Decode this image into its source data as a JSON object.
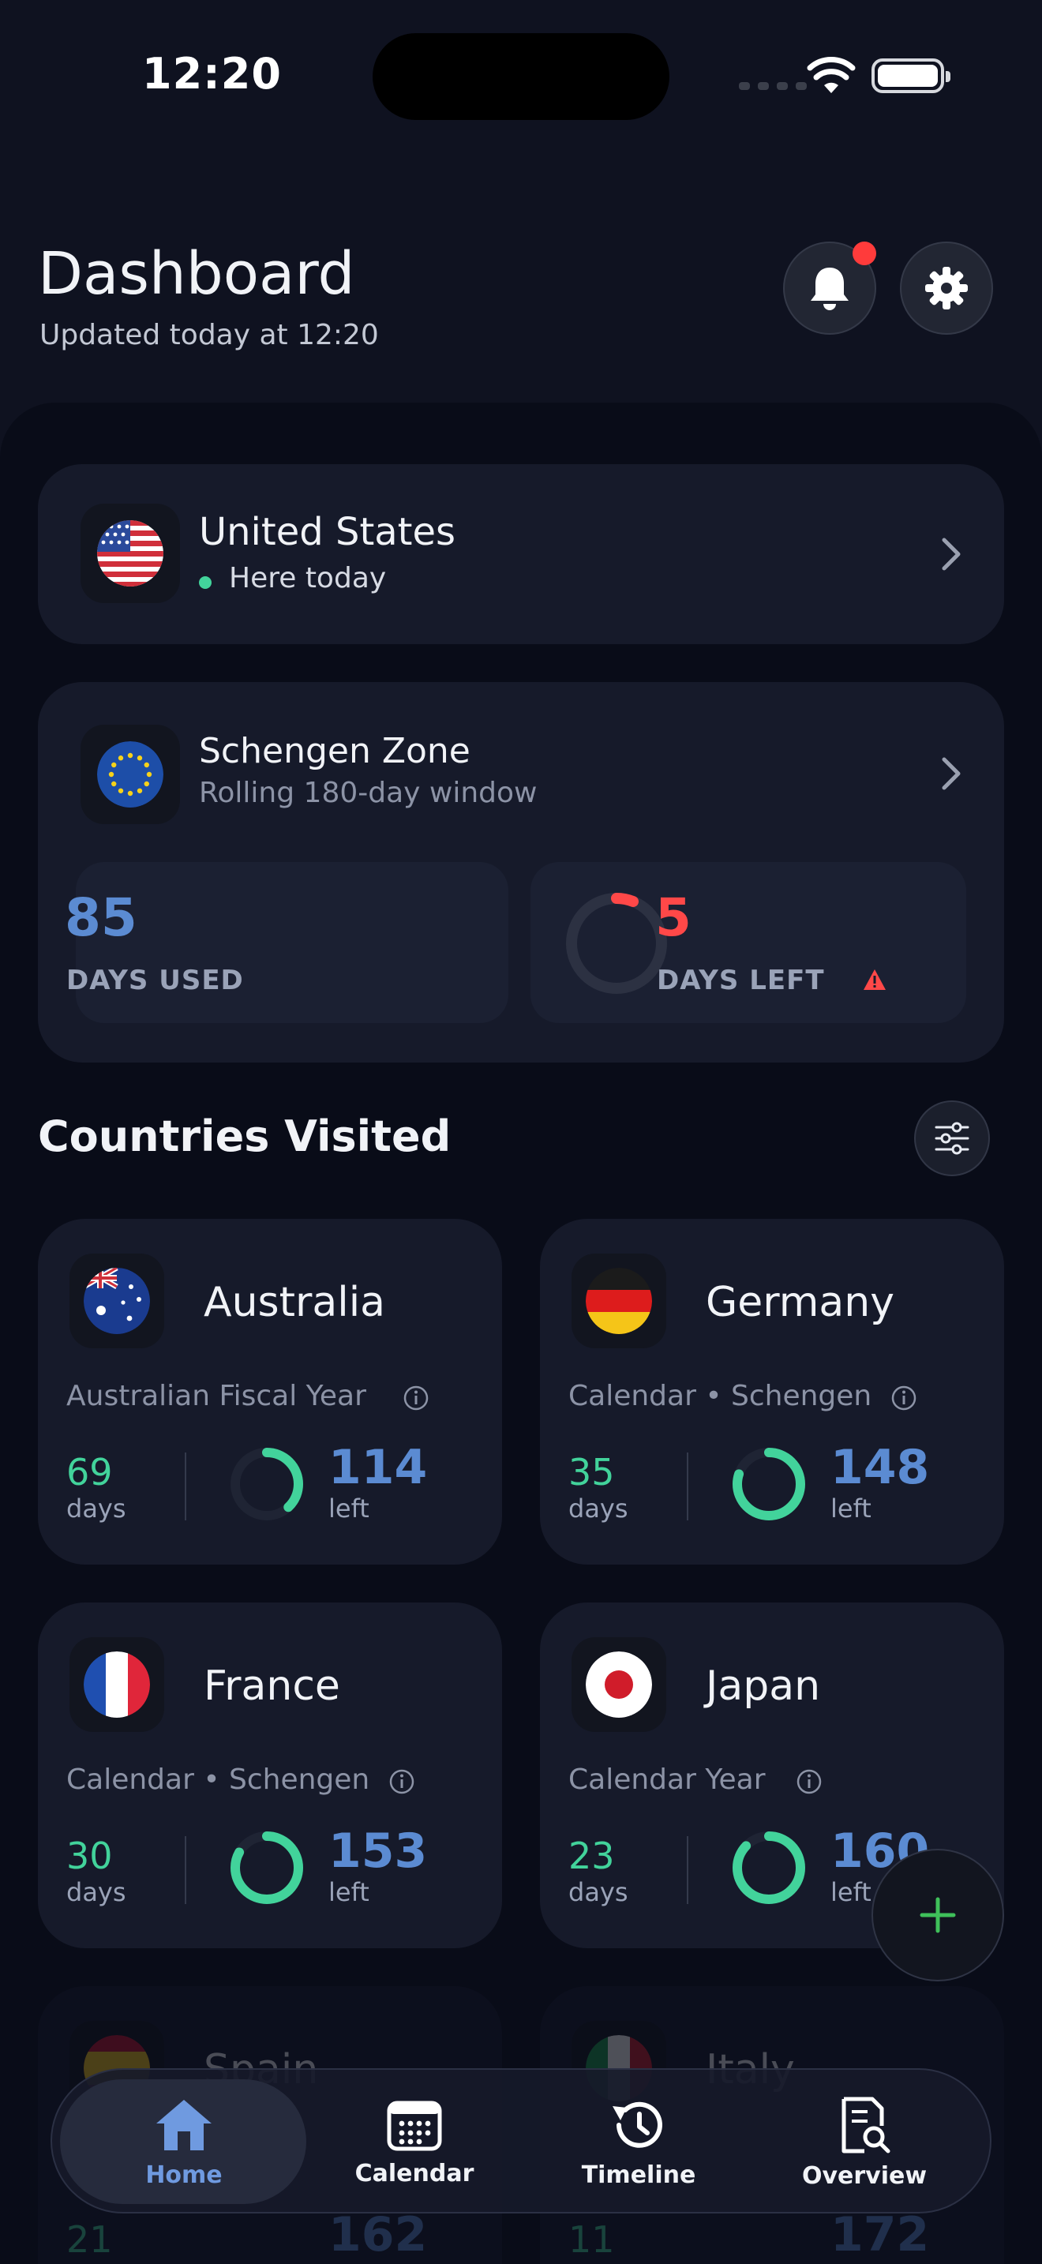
{
  "status_bar": {
    "time": "12:20"
  },
  "header": {
    "title": "Dashboard",
    "subtitle": "Updated today at 12:20"
  },
  "current_location": {
    "country": "United States",
    "status": "Here today",
    "flag_icon": "us-flag-icon"
  },
  "schengen": {
    "title": "Schengen Zone",
    "subtitle": "Rolling 180-day window",
    "days_used": "85",
    "days_used_label": "DAYS USED",
    "days_left": "5",
    "days_left_label": "DAYS LEFT",
    "days_left_fraction": 0.06,
    "warning_color": "#ff4848"
  },
  "countries_section": {
    "title": "Countries Visited"
  },
  "countries": [
    {
      "name": "Australia",
      "rule": "Australian Fiscal Year",
      "days": "69",
      "days_label": "days",
      "left": "114",
      "left_label": "left",
      "progress": 0.38
    },
    {
      "name": "Germany",
      "rule": "Calendar • Schengen",
      "days": "35",
      "days_label": "days",
      "left": "148",
      "left_label": "left",
      "progress": 0.8
    },
    {
      "name": "France",
      "rule": "Calendar • Schengen",
      "days": "30",
      "days_label": "days",
      "left": "153",
      "left_label": "left",
      "progress": 0.83
    },
    {
      "name": "Japan",
      "rule": "Calendar Year",
      "days": "23",
      "days_label": "days",
      "left": "160",
      "left_label": "left",
      "progress": 0.87
    },
    {
      "name": "Spain",
      "days": "21",
      "left": "162"
    },
    {
      "name": "Italy",
      "days": "11",
      "left": "172"
    }
  ],
  "tab_bar": {
    "tabs": [
      {
        "label": "Home",
        "icon": "home-icon",
        "active": true
      },
      {
        "label": "Calendar",
        "icon": "calendar-icon",
        "active": false
      },
      {
        "label": "Timeline",
        "icon": "history-icon",
        "active": false
      },
      {
        "label": "Overview",
        "icon": "document-search-icon",
        "active": false
      }
    ]
  },
  "colors": {
    "accent_blue": "#5b8bd2",
    "accent_green": "#42d39b",
    "alert_red": "#ff3b3b"
  }
}
